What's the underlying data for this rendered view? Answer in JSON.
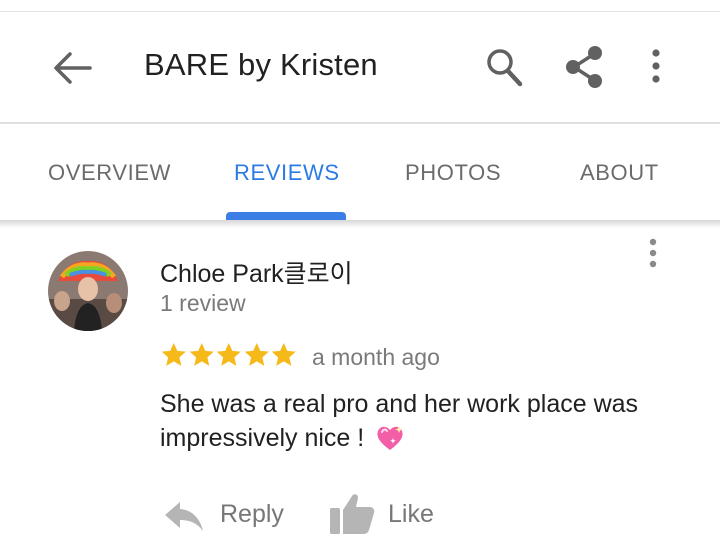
{
  "app_bar": {
    "title": "BARE by Kristen",
    "back_icon": "arrow-left-icon",
    "search_icon": "search-icon",
    "share_icon": "share-icon",
    "more_icon": "more-vert-icon"
  },
  "tabs": [
    {
      "label": "OVERVIEW",
      "active": false
    },
    {
      "label": "REVIEWS",
      "active": true
    },
    {
      "label": "PHOTOS",
      "active": false
    },
    {
      "label": "ABOUT",
      "active": false
    }
  ],
  "review": {
    "author": "Chloe Park클로이",
    "review_count": "1 review",
    "rating": 5,
    "rating_max": 5,
    "date": "a month ago",
    "text": "She was a real pro and her work place was impressively nice ! ",
    "emoji_icon": "sparkling-heart-icon",
    "actions": {
      "reply_label": "Reply",
      "like_label": "Like"
    }
  },
  "colors": {
    "accent": "#2c7be5",
    "star": "#f6b91a",
    "secondary_text": "#7a7a7a",
    "action_icon": "#b5b5b5"
  }
}
